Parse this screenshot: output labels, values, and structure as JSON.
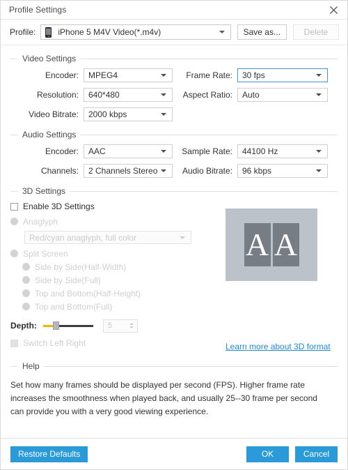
{
  "window": {
    "title": "Profile Settings",
    "close_icon": "close-icon"
  },
  "profile": {
    "label": "Profile:",
    "selected": "iPhone 5 M4V Video(*.m4v)",
    "device_icon": "phone-icon",
    "save_as_label": "Save as...",
    "delete_label": "Delete"
  },
  "video_settings": {
    "title": "Video Settings",
    "encoder_label": "Encoder:",
    "encoder_value": "MPEG4",
    "resolution_label": "Resolution:",
    "resolution_value": "640*480",
    "bitrate_label": "Video Bitrate:",
    "bitrate_value": "2000 kbps",
    "frame_rate_label": "Frame Rate:",
    "frame_rate_value": "30 fps",
    "aspect_ratio_label": "Aspect Ratio:",
    "aspect_ratio_value": "Auto",
    "focus_accent": "#3f97d9"
  },
  "audio_settings": {
    "title": "Audio Settings",
    "encoder_label": "Encoder:",
    "encoder_value": "AAC",
    "channels_label": "Channels:",
    "channels_value": "2 Channels Stereo",
    "sample_rate_label": "Sample Rate:",
    "sample_rate_value": "44100 Hz",
    "audio_bitrate_label": "Audio Bitrate:",
    "audio_bitrate_value": "96 kbps"
  },
  "three_d_settings": {
    "title": "3D Settings",
    "enable_label": "Enable 3D Settings",
    "anaglyph_label": "Anaglyph",
    "anaglyph_value": "Red/cyan anaglyph, full color",
    "split_screen_label": "Split Screen",
    "split_options": [
      "Side by Side(Half-Width)",
      "Side by Side(Full)",
      "Top and Bottom(Half-Height)",
      "Top and Bottom(Full)"
    ],
    "depth_label": "Depth:",
    "depth_value": "5",
    "switch_label": "Switch Left Right",
    "learn_more_label": "Learn more about 3D format",
    "link_color": "#1f8ad6",
    "slider_fill_color": "#f5b301",
    "preview_letters": [
      "A",
      "A"
    ]
  },
  "help": {
    "title": "Help",
    "text": "Set how many frames should be displayed per second (FPS). Higher frame rate increases the smoothness when played back, and usually 25--30 frame per second can provide you with a very good viewing experience."
  },
  "footer": {
    "restore_label": "Restore Defaults",
    "ok_label": "OK",
    "cancel_label": "Cancel",
    "button_color": "#2a9ad9"
  }
}
